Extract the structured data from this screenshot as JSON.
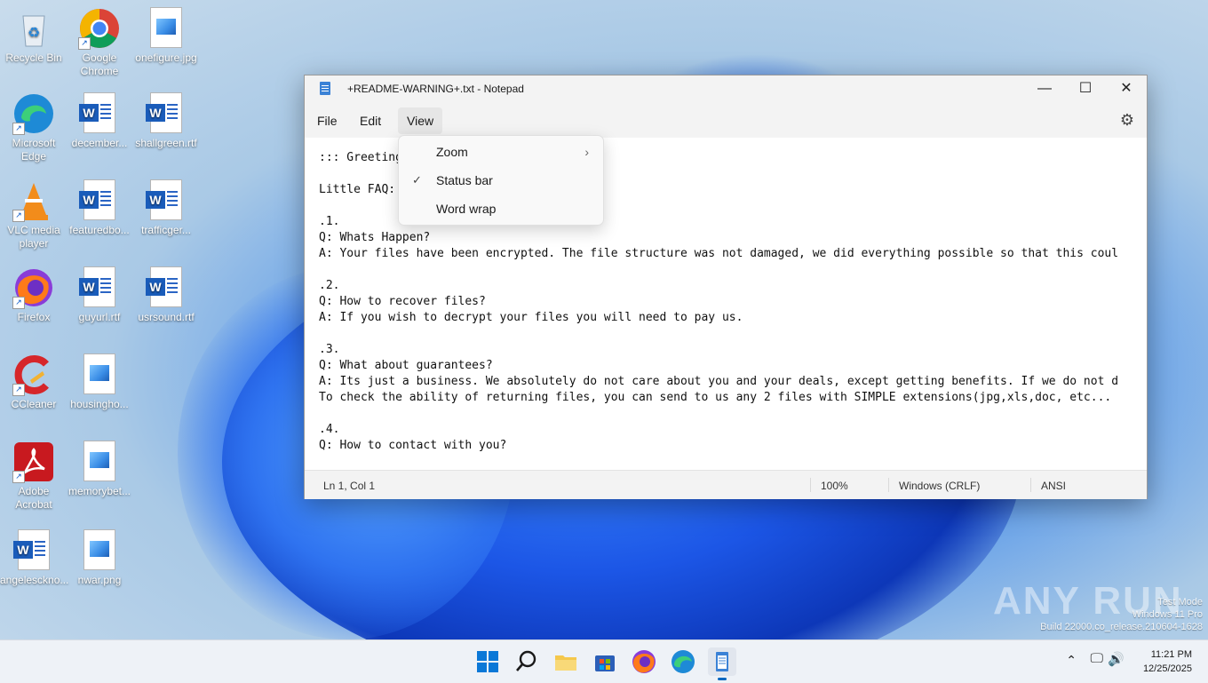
{
  "desktop": {
    "icons": [
      {
        "label": "Recycle Bin"
      },
      {
        "label": "Google Chrome"
      },
      {
        "label": "onefigure.jpg"
      },
      {
        "label": "Microsoft Edge"
      },
      {
        "label": "december..."
      },
      {
        "label": "shallgreen.rtf"
      },
      {
        "label": "VLC media player"
      },
      {
        "label": "featuredbo..."
      },
      {
        "label": "trafficger..."
      },
      {
        "label": "Firefox"
      },
      {
        "label": "guyurl.rtf"
      },
      {
        "label": "usrsound.rtf"
      },
      {
        "label": "CCleaner"
      },
      {
        "label": "housingho..."
      },
      {
        "label": "Adobe Acrobat"
      },
      {
        "label": "memorybet..."
      },
      {
        "label": "angelesckno..."
      },
      {
        "label": "nwar.png"
      }
    ]
  },
  "notepad": {
    "title": "+README-WARNING+.txt - Notepad",
    "menu": {
      "file": "File",
      "edit": "Edit",
      "view": "View"
    },
    "content": "::: Greetings :::\n\nLittle FAQ:\n\n.1.\nQ: Whats Happen?\nA: Your files have been encrypted. The file structure was not damaged, we did everything possible so that this coul\n\n.2.\nQ: How to recover files?\nA: If you wish to decrypt your files you will need to pay us.\n\n.3.\nQ: What about guarantees?\nA: Its just a business. We absolutely do not care about you and your deals, except getting benefits. If we do not d\nTo check the ability of returning files, you can send to us any 2 files with SIMPLE extensions(jpg,xls,doc, etc...\n\n.4.\nQ: How to contact with you?",
    "status": {
      "position": "Ln 1, Col 1",
      "zoom": "100%",
      "line_ending": "Windows (CRLF)",
      "encoding": "ANSI"
    },
    "view_menu": {
      "zoom": "Zoom",
      "status_bar": "Status bar",
      "status_bar_checked": true,
      "word_wrap": "Word wrap"
    }
  },
  "watermark": {
    "brand": "ANY RUN",
    "line1": "Test Mode",
    "line2": "Windows 11 Pro",
    "line3": "Build 22000.co_release.210604-1628"
  },
  "taskbar": {
    "time": "11:21 PM",
    "date": "12/25/2025"
  },
  "colors": {
    "accent": "#0067c0",
    "titlebar": "#f3f3f3"
  }
}
